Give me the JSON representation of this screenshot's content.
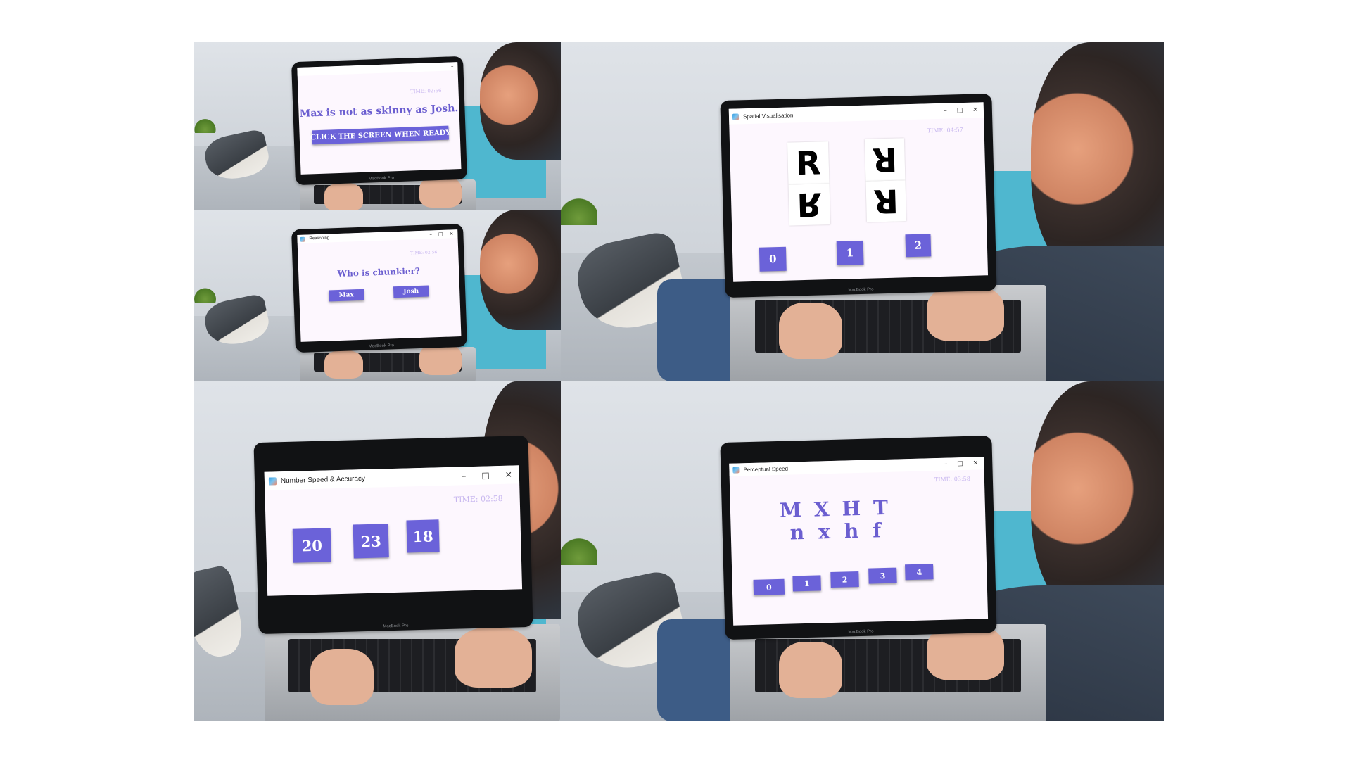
{
  "panels": {
    "reasoning_intro": {
      "timer": "TIME: 02:56",
      "statement": "Max is not as skinny as Josh.",
      "ready_button": "CLICK THE SCREEN WHEN READY",
      "device_label": "MacBook Pro"
    },
    "reasoning_question": {
      "window_title": "Reasoning",
      "timer": "TIME: 02:56",
      "question": "Who is chunkier?",
      "options": [
        "Max",
        "Josh"
      ],
      "device_label": "MacBook Pro"
    },
    "spatial": {
      "window_title": "Spatial Visualisation",
      "timer": "TIME: 04:57",
      "tiles": [
        "R",
        "R",
        "R",
        "R"
      ],
      "options": [
        "0",
        "1",
        "2"
      ],
      "device_label": "MacBook Pro"
    },
    "number": {
      "window_title": "Number Speed & Accuracy",
      "timer": "TIME: 02:58",
      "numbers": [
        "20",
        "23",
        "18"
      ],
      "device_label": "MacBook Pro"
    },
    "perceptual": {
      "window_title": "Perceptual Speed",
      "timer": "TIME: 03:58",
      "upper_letters": [
        "M",
        "X",
        "H",
        "T"
      ],
      "lower_letters": [
        "n",
        "x",
        "h",
        "f"
      ],
      "options": [
        "0",
        "1",
        "2",
        "3",
        "4"
      ],
      "device_label": "MacBook Pro"
    }
  },
  "icons": {
    "minimize": "minimize-icon",
    "maximize": "maximize-icon",
    "close": "close-icon",
    "app": "app-logo-icon"
  },
  "colors": {
    "button": "#6b62d9",
    "prompt_text": "#6b5ed0",
    "timer_text": "#c7b6ef",
    "screen_bg": "#fdf7fe"
  }
}
